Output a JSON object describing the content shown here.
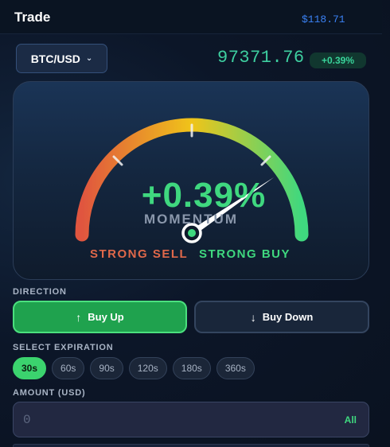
{
  "header": {
    "title": "Trade",
    "balance": "$118.71"
  },
  "market": {
    "pair": "BTC/USD",
    "price": "97371.76",
    "change": "+0.39%"
  },
  "gauge": {
    "value_text": "+0.39%",
    "caption": "MOMENTUM",
    "left_label": "STRONG SELL",
    "right_label": "STRONG BUY",
    "needle_level": 0.81,
    "colors": {
      "sell": "#e0684a",
      "neutral": "#f0c419",
      "buy": "#3fd87f"
    }
  },
  "direction": {
    "label": "DIRECTION",
    "buttons": [
      {
        "label": "Buy Up",
        "icon": "arrow-up-icon",
        "active": true
      },
      {
        "label": "Buy Down",
        "icon": "arrow-down-icon",
        "active": false
      }
    ]
  },
  "expiration": {
    "label": "SELECT EXPIRATION",
    "options": [
      "30s",
      "60s",
      "90s",
      "120s",
      "180s",
      "360s"
    ],
    "selected": "30s"
  },
  "amount": {
    "label": "AMOUNT (USD)",
    "value": "",
    "placeholder": "0",
    "all_label": "All"
  }
}
